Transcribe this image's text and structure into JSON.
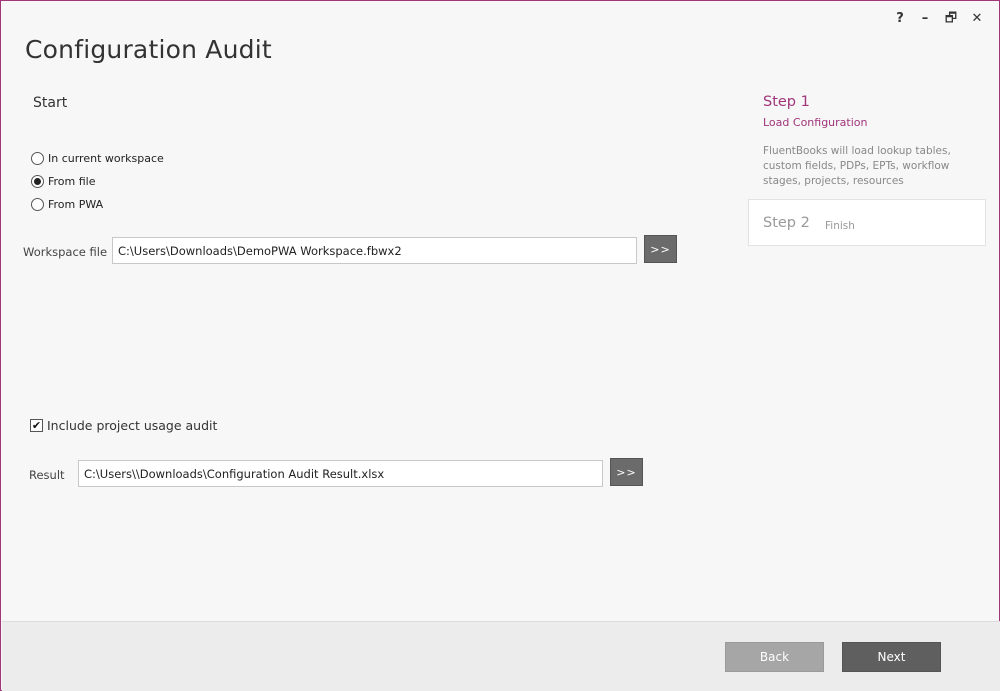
{
  "window": {
    "title": "Configuration Audit",
    "controls": {
      "help": "?",
      "minimize": "–",
      "restore": "🗗",
      "close": "✕"
    }
  },
  "main": {
    "section_title": "Start",
    "source_options": [
      {
        "label": "In current workspace",
        "checked": false
      },
      {
        "label": "From file",
        "checked": true
      },
      {
        "label": "From PWA",
        "checked": false
      }
    ],
    "workspace_file": {
      "label": "Workspace file",
      "value": "C:\\Users\\Downloads\\DemoPWA Workspace.fbwx2",
      "browse_label": ">>"
    },
    "include_usage": {
      "label": "Include project usage audit",
      "checked": true
    },
    "result": {
      "label": "Result",
      "value": "C:\\Users\\\\Downloads\\Configuration Audit Result.xlsx",
      "browse_label": ">>"
    }
  },
  "steps": [
    {
      "title": "Step 1",
      "subtitle": "Load Configuration",
      "description": "FluentBooks will load lookup tables, custom fields, PDPs, EPTs, workflow stages, projects, resources",
      "active": true
    },
    {
      "title": "Step 2",
      "subtitle": "Finish",
      "active": false
    }
  ],
  "footer": {
    "back_label": "Back",
    "next_label": "Next"
  },
  "colors": {
    "accent": "#a0357a",
    "button_dark": "#5f5f5f",
    "button_disabled": "#a6a6a6"
  }
}
